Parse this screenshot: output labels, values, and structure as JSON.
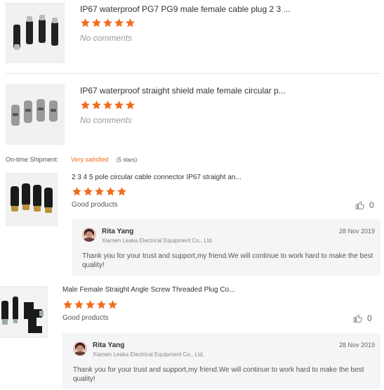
{
  "products": [
    {
      "title": "IP67 waterproof PG7 PG9 male female cable plug 2 3 ...",
      "rating": 5,
      "comment": "No comments"
    },
    {
      "title": "IP67 waterproof straight shield male female circular p...",
      "rating": 5,
      "comment": "No comments"
    }
  ],
  "shipment": {
    "label": "On-time Shipment:",
    "value": "Very satisfied",
    "stars_text": "(5 stars)"
  },
  "reviews": [
    {
      "title": "2 3 4 5 pole circular cable connector IP67 straight an...",
      "rating": 5,
      "text": "Good products",
      "likes": "0",
      "reply": {
        "name": "Rita Yang",
        "company": "Xiamen Leaka Electrical Equipment Co., Ltd.",
        "date": "28 Nov 2019",
        "line1": "Thank you for your trust and support,my friend.We will continue to work hard to make the best",
        "line2": "quality!"
      }
    },
    {
      "title": "Male Female Straight Angle Screw Threaded Plug Co...",
      "rating": 5,
      "text": "Good products",
      "likes": "0",
      "reply": {
        "name": "Rita Yang",
        "company": "Xiamen Leaka Electrical Equipment Co., Ltd.",
        "date": "28 Nov 2019",
        "line1": "Thank you for your trust and support,my friend.We will continue to work hard to make the best",
        "line2": "quality!"
      }
    }
  ],
  "colors": {
    "star": "#f26b1d",
    "accent": "#f26b1d"
  },
  "icons": {
    "star": "star-icon",
    "like": "thumbs-up-icon"
  }
}
